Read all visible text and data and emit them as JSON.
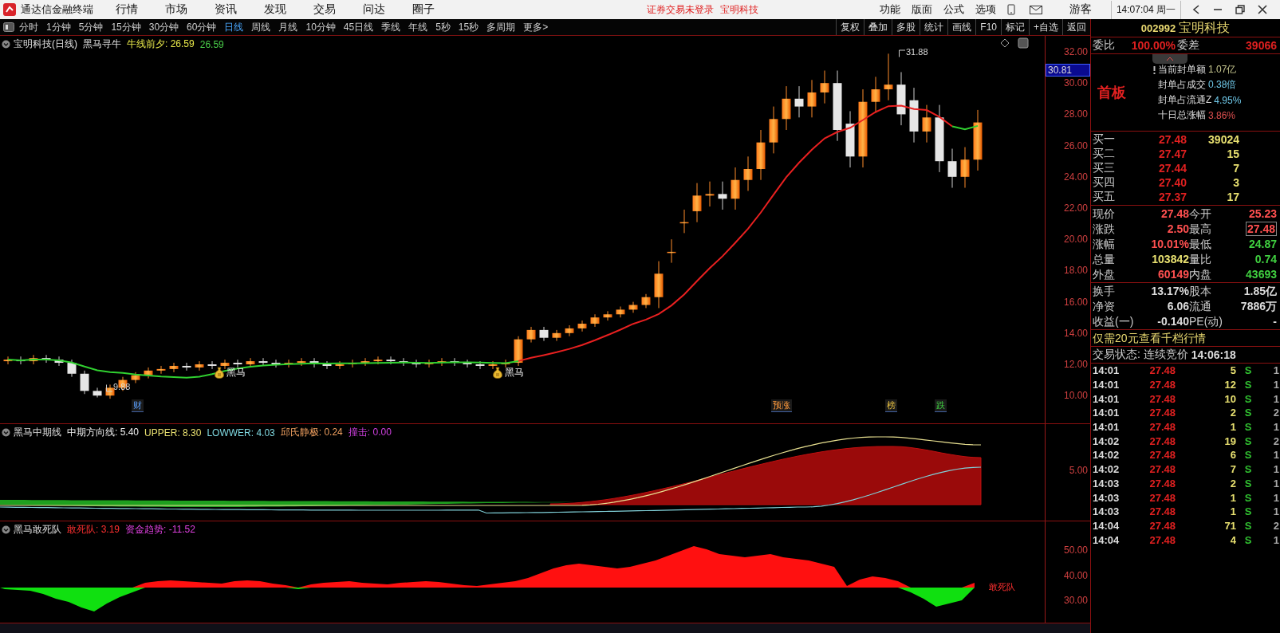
{
  "title_bar": {
    "app_name": "通达信金融终端",
    "menus": [
      "行情",
      "市场",
      "资讯",
      "发现",
      "交易",
      "问达",
      "圈子"
    ],
    "notice": "证券交易未登录",
    "stock_name": "宝明科技",
    "right_menus": [
      "功能",
      "版面",
      "公式",
      "选项"
    ],
    "user": "游客",
    "clock": "14:07:04 周一"
  },
  "period_tabs": [
    {
      "label": "分时",
      "selected": false
    },
    {
      "label": "1分钟",
      "selected": false
    },
    {
      "label": "5分钟",
      "selected": false
    },
    {
      "label": "15分钟",
      "selected": false
    },
    {
      "label": "30分钟",
      "selected": false
    },
    {
      "label": "60分钟",
      "selected": false
    },
    {
      "label": "日线",
      "selected": true
    },
    {
      "label": "周线",
      "selected": false
    },
    {
      "label": "月线",
      "selected": false
    },
    {
      "label": "10分钟",
      "selected": false
    },
    {
      "label": "45日线",
      "selected": false
    },
    {
      "label": "季线",
      "selected": false
    },
    {
      "label": "年线",
      "selected": false
    },
    {
      "label": "5秒",
      "selected": false
    },
    {
      "label": "15秒",
      "selected": false
    },
    {
      "label": "多周期",
      "selected": false
    },
    {
      "label": "更多>",
      "selected": false
    }
  ],
  "tools": [
    "复权",
    "叠加",
    "多股",
    "统计",
    "画线",
    "F10",
    "标记",
    "+自选",
    "返回"
  ],
  "main_chart": {
    "title": "宝明科技(日线)",
    "indicator": "黑马寻牛",
    "values": [
      {
        "text": "牛线前夕: 26.59",
        "color": "#e8e84a"
      },
      {
        "text": "26.59",
        "color": "#4ad04a"
      }
    ],
    "price_tag": "30.81",
    "y_labels": [
      "32.00",
      "30.00",
      "28.00",
      "26.00",
      "24.00",
      "22.00",
      "20.00",
      "18.00",
      "16.00",
      "14.00",
      "12.00",
      "10.00"
    ],
    "annotations": [
      {
        "kind": "price",
        "text": "31.88"
      },
      {
        "kind": "price",
        "text": "9.88"
      },
      {
        "kind": "signal",
        "text": "黑马"
      },
      {
        "kind": "signal",
        "text": "黑马"
      },
      {
        "kind": "marker",
        "text": "财"
      },
      {
        "kind": "marker",
        "text": "预涨"
      },
      {
        "kind": "marker",
        "text": "榜"
      },
      {
        "kind": "marker",
        "text": "跌"
      }
    ]
  },
  "indicator_1": {
    "name": "黑马中期线",
    "values": [
      {
        "text": "中期方向线: 5.40",
        "color": "#f0f0f0"
      },
      {
        "text": "UPPER: 8.30",
        "color": "#e8e070"
      },
      {
        "text": "LOWWER: 4.03",
        "color": "#7fd8e0"
      },
      {
        "text": "邱氏静极: 0.24",
        "color": "#f0a060"
      },
      {
        "text": "撞击: 0.00",
        "color": "#d040e0"
      }
    ],
    "y_labels": [
      "5.00"
    ]
  },
  "indicator_2": {
    "name": "黑马敢死队",
    "values": [
      {
        "text": "敢死队: 3.19",
        "color": "#ff3030"
      },
      {
        "text": "资金趋势: -11.52",
        "color": "#e040e0"
      }
    ],
    "y_labels": [
      "50.00",
      "40.00",
      "30.00"
    ],
    "end_label": "敢死队"
  },
  "quote_panel": {
    "code": "002992",
    "name": "宝明科技",
    "wei_bi": {
      "label": "委比",
      "value": "100.00%"
    },
    "wei_cha": {
      "label": "委差",
      "value": "39066"
    },
    "board": "首板",
    "seal_info": [
      {
        "label": "当前封单额",
        "value": "1.07亿",
        "color": "#c8c890"
      },
      {
        "label": "封单占成交",
        "value": "0.38倍",
        "color": "#6fc8e8"
      },
      {
        "label": "封单占流通Z",
        "value": "4.95%",
        "color": "#6fc8e8"
      },
      {
        "label": "十日总涨幅",
        "value": "3.86%",
        "color": "#e05050"
      }
    ],
    "bids": [
      {
        "label": "买一",
        "price": "27.48",
        "volume": "39024"
      },
      {
        "label": "买二",
        "price": "27.47",
        "volume": "15"
      },
      {
        "label": "买三",
        "price": "27.44",
        "volume": "7"
      },
      {
        "label": "买四",
        "price": "27.40",
        "volume": "3"
      },
      {
        "label": "买五",
        "price": "27.37",
        "volume": "17"
      }
    ],
    "quotes": [
      {
        "label": "现价",
        "value": "27.48",
        "kind": "up",
        "highlighted": false
      },
      {
        "label": "今开",
        "value": "25.23",
        "kind": "up",
        "highlighted": false
      },
      {
        "label": "涨跌",
        "value": "2.50",
        "kind": "up",
        "highlighted": false
      },
      {
        "label": "最高",
        "value": "27.48",
        "kind": "up",
        "highlighted": true
      },
      {
        "label": "涨幅",
        "value": "10.01%",
        "kind": "up",
        "highlighted": false
      },
      {
        "label": "最低",
        "value": "24.87",
        "kind": "down",
        "highlighted": false
      },
      {
        "label": "总量",
        "value": "103842",
        "kind": "volume",
        "highlighted": false
      },
      {
        "label": "量比",
        "value": "0.74",
        "kind": "down",
        "highlighted": false
      },
      {
        "label": "外盘",
        "value": "60149",
        "kind": "up",
        "highlighted": false
      },
      {
        "label": "内盘",
        "value": "43693",
        "kind": "down",
        "highlighted": false
      }
    ],
    "stats": [
      {
        "label": "换手",
        "value": "13.17%"
      },
      {
        "label": "股本",
        "value": "1.85亿"
      },
      {
        "label": "净资",
        "value": "6.06"
      },
      {
        "label": "流通",
        "value": "7886万"
      },
      {
        "label": "收益(一)",
        "value": "-0.140"
      },
      {
        "label": "PE(动)",
        "value": "-"
      }
    ],
    "promo": "仅需20元查看千档行情",
    "status": {
      "label": "交易状态: 连续竞价",
      "time": "14:06:18"
    },
    "ticks": [
      {
        "time": "14:01",
        "price": "27.48",
        "volume": "5",
        "side": "S",
        "count": "1"
      },
      {
        "time": "14:01",
        "price": "27.48",
        "volume": "12",
        "side": "S",
        "count": "1"
      },
      {
        "time": "14:01",
        "price": "27.48",
        "volume": "10",
        "side": "S",
        "count": "1"
      },
      {
        "time": "14:01",
        "price": "27.48",
        "volume": "2",
        "side": "S",
        "count": "2"
      },
      {
        "time": "14:01",
        "price": "27.48",
        "volume": "1",
        "side": "S",
        "count": "1"
      },
      {
        "time": "14:02",
        "price": "27.48",
        "volume": "19",
        "side": "S",
        "count": "2"
      },
      {
        "time": "14:02",
        "price": "27.48",
        "volume": "6",
        "side": "S",
        "count": "1"
      },
      {
        "time": "14:02",
        "price": "27.48",
        "volume": "7",
        "side": "S",
        "count": "1"
      },
      {
        "time": "14:03",
        "price": "27.48",
        "volume": "2",
        "side": "S",
        "count": "1"
      },
      {
        "time": "14:03",
        "price": "27.48",
        "volume": "1",
        "side": "S",
        "count": "1"
      },
      {
        "time": "14:03",
        "price": "27.48",
        "volume": "1",
        "side": "S",
        "count": "1"
      },
      {
        "time": "14:04",
        "price": "27.48",
        "volume": "71",
        "side": "S",
        "count": "2"
      },
      {
        "time": "14:04",
        "price": "27.48",
        "volume": "4",
        "side": "S",
        "count": "1"
      }
    ]
  }
}
